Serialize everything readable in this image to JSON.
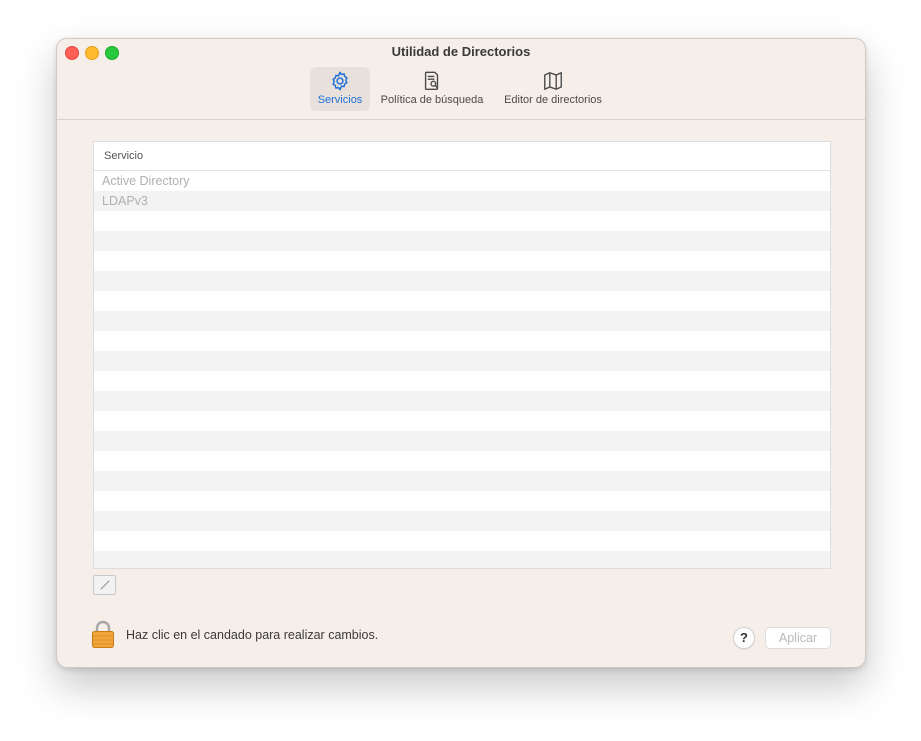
{
  "window": {
    "title": "Utilidad de Directorios"
  },
  "toolbar": {
    "items": [
      {
        "label": "Servicios",
        "icon": "gear-icon",
        "active": true
      },
      {
        "label": "Política de búsqueda",
        "icon": "search-document-icon",
        "active": false
      },
      {
        "label": "Editor de directorios",
        "icon": "map-icon",
        "active": false
      }
    ]
  },
  "table": {
    "header": "Servicio",
    "rows": [
      "Active Directory",
      "LDAPv3"
    ]
  },
  "edit_button": {
    "icon": "pencil-icon"
  },
  "footer": {
    "lock_icon": "lock-icon",
    "lock_message": "Haz clic en el candado para realizar cambios.",
    "help_label": "?",
    "apply_label": "Aplicar"
  },
  "colors": {
    "accent": "#1f6fd6",
    "window_bg": "#f6eee9",
    "close": "#fe5f57",
    "minimize": "#febc2e",
    "maximize": "#28c840"
  }
}
